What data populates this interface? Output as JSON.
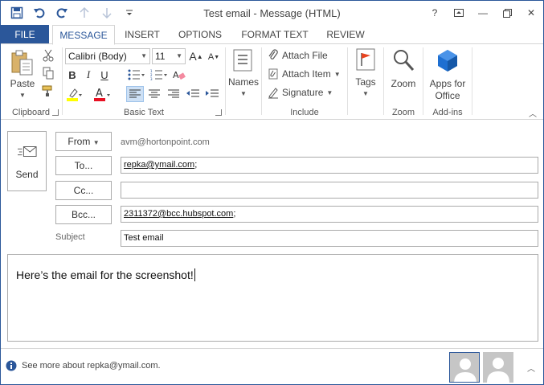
{
  "window": {
    "title": "Test email - Message (HTML)"
  },
  "title_controls": {
    "help": "?",
    "minimize": "—",
    "close": "✕"
  },
  "tabs": [
    {
      "label": "FILE"
    },
    {
      "label": "MESSAGE"
    },
    {
      "label": "INSERT"
    },
    {
      "label": "OPTIONS"
    },
    {
      "label": "FORMAT TEXT"
    },
    {
      "label": "REVIEW"
    }
  ],
  "ribbon": {
    "clipboard": {
      "paste": "Paste",
      "label": "Clipboard"
    },
    "basic_text": {
      "font": "Calibri (Body)",
      "size": "11",
      "bold": "B",
      "italic": "I",
      "underline": "U",
      "grow": "A",
      "shrink": "A",
      "label": "Basic Text"
    },
    "names": {
      "label": "Names"
    },
    "include": {
      "attach_file": "Attach File",
      "attach_item": "Attach Item",
      "signature": "Signature",
      "label": "Include"
    },
    "tags": {
      "label": "Tags"
    },
    "zoom": {
      "button": "Zoom",
      "label": "Zoom"
    },
    "addins": {
      "apps_line1": "Apps for",
      "apps_line2": "Office",
      "label": "Add-ins"
    }
  },
  "compose": {
    "send": "Send",
    "from_button": "From",
    "from_value": "avm@hortonpoint.com",
    "to_button": "To...",
    "to_value": "repka@ymail.com",
    "to_sep": ";",
    "cc_button": "Cc...",
    "cc_value": "",
    "bcc_button": "Bcc...",
    "bcc_value": "2311372@bcc.hubspot.com",
    "bcc_sep": ";",
    "subject_label": "Subject",
    "subject_value": "Test email",
    "body_text": "Here’s the email for the screenshot!"
  },
  "people_pane": {
    "info_text": "See more about repka@ymail.com."
  },
  "colors": {
    "accent": "#2b579a",
    "highlight": "#ffff00",
    "font_color": "#e81123",
    "apps_icon": "#1e6fd1",
    "tags_flag": "#e8431f"
  }
}
